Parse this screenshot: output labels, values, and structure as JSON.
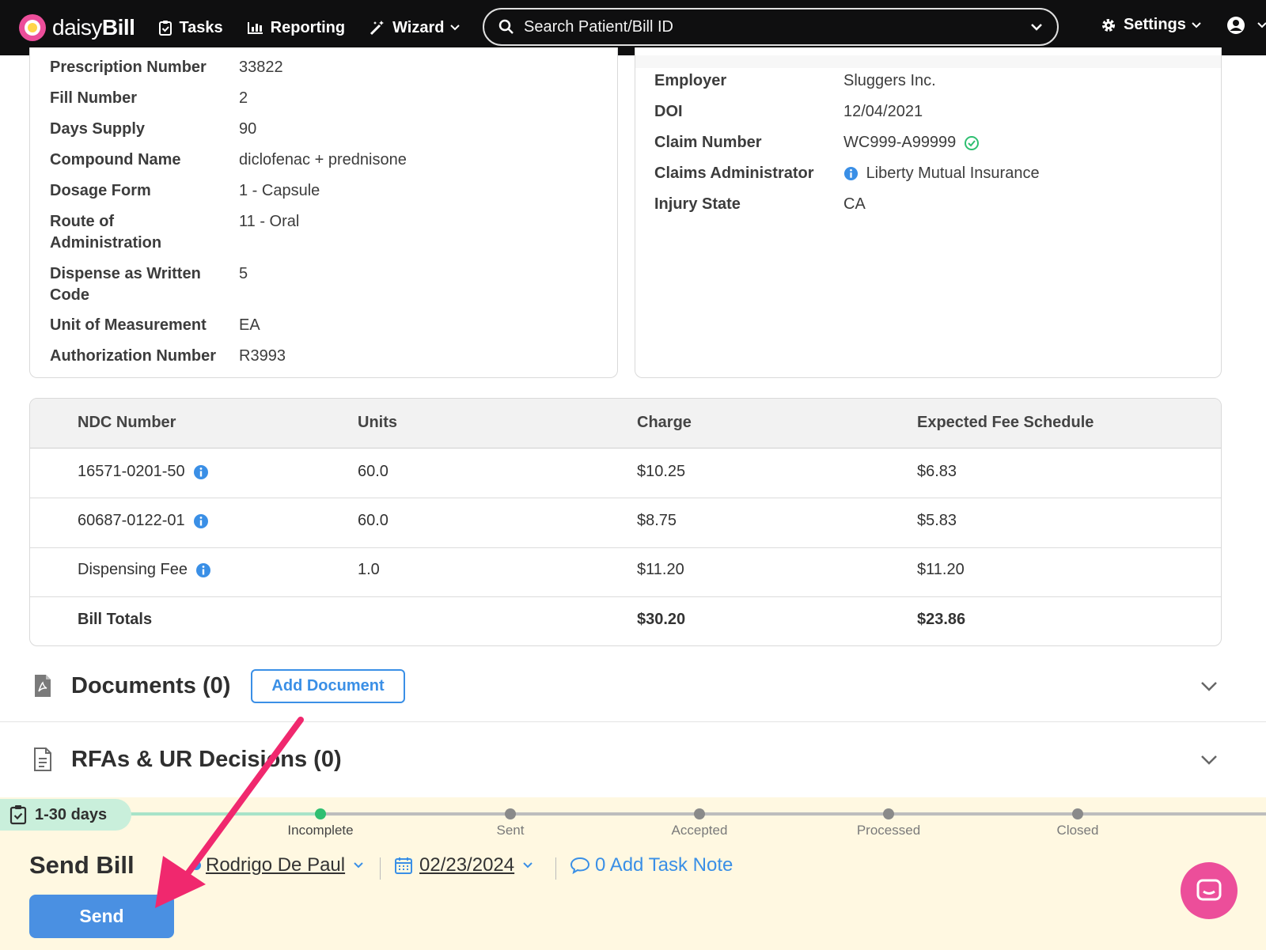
{
  "navbar": {
    "brand_prefix": "daisy",
    "brand_suffix": "Bill",
    "tasks": "Tasks",
    "reporting": "Reporting",
    "wizard": "Wizard",
    "search_placeholder": "Search Patient/Bill ID",
    "settings": "Settings"
  },
  "prescription": {
    "rows": [
      {
        "label": "Prescription Number",
        "value": "33822"
      },
      {
        "label": "Fill Number",
        "value": "2"
      },
      {
        "label": "Days Supply",
        "value": "90"
      },
      {
        "label": "Compound Name",
        "value": "diclofenac + prednisone"
      },
      {
        "label": "Dosage Form",
        "value": "1 - Capsule"
      },
      {
        "label": "Route of Administration",
        "value": "11 - Oral"
      },
      {
        "label": "Dispense as Written Code",
        "value": "5"
      },
      {
        "label": "Unit of Measurement",
        "value": "EA"
      },
      {
        "label": "Authorization Number",
        "value": "R3993"
      }
    ]
  },
  "claim": {
    "rows": [
      {
        "label": "Employer",
        "value": "Sluggers Inc."
      },
      {
        "label": "DOI",
        "value": "12/04/2021"
      },
      {
        "label": "Claim Number",
        "value": "WC999-A99999"
      },
      {
        "label": "Claims Administrator",
        "value": "Liberty Mutual Insurance"
      },
      {
        "label": "Injury State",
        "value": "CA"
      }
    ]
  },
  "lines_table": {
    "headers": [
      "NDC Number",
      "Units",
      "Charge",
      "Expected Fee Schedule"
    ],
    "rows": [
      [
        "16571-0201-50",
        "60.0",
        "$10.25",
        "$6.83"
      ],
      [
        "60687-0122-01",
        "60.0",
        "$8.75",
        "$5.83"
      ],
      [
        "Dispensing Fee",
        "1.0",
        "$11.20",
        "$11.20"
      ]
    ],
    "totals_label": "Bill Totals",
    "total_charge": "$30.20",
    "total_expected": "$23.86"
  },
  "documents": {
    "title": "Documents (0)",
    "add_button": "Add Document"
  },
  "rfas": {
    "title": "RFAs & UR Decisions (0)"
  },
  "task": {
    "days": "1-30 days",
    "steps": [
      "Incomplete",
      "Sent",
      "Accepted",
      "Processed",
      "Closed"
    ],
    "title": "Send Bill",
    "assignee": "Rodrigo De Paul",
    "due_date": "02/23/2024",
    "task_note": "0 Add Task Note",
    "send_button": "Send"
  },
  "colors": {
    "accent": "#3a8fe6",
    "brand_pink": "#ec4e9a",
    "progress_done": "#2fbf71",
    "arrow": "#f0286e"
  }
}
